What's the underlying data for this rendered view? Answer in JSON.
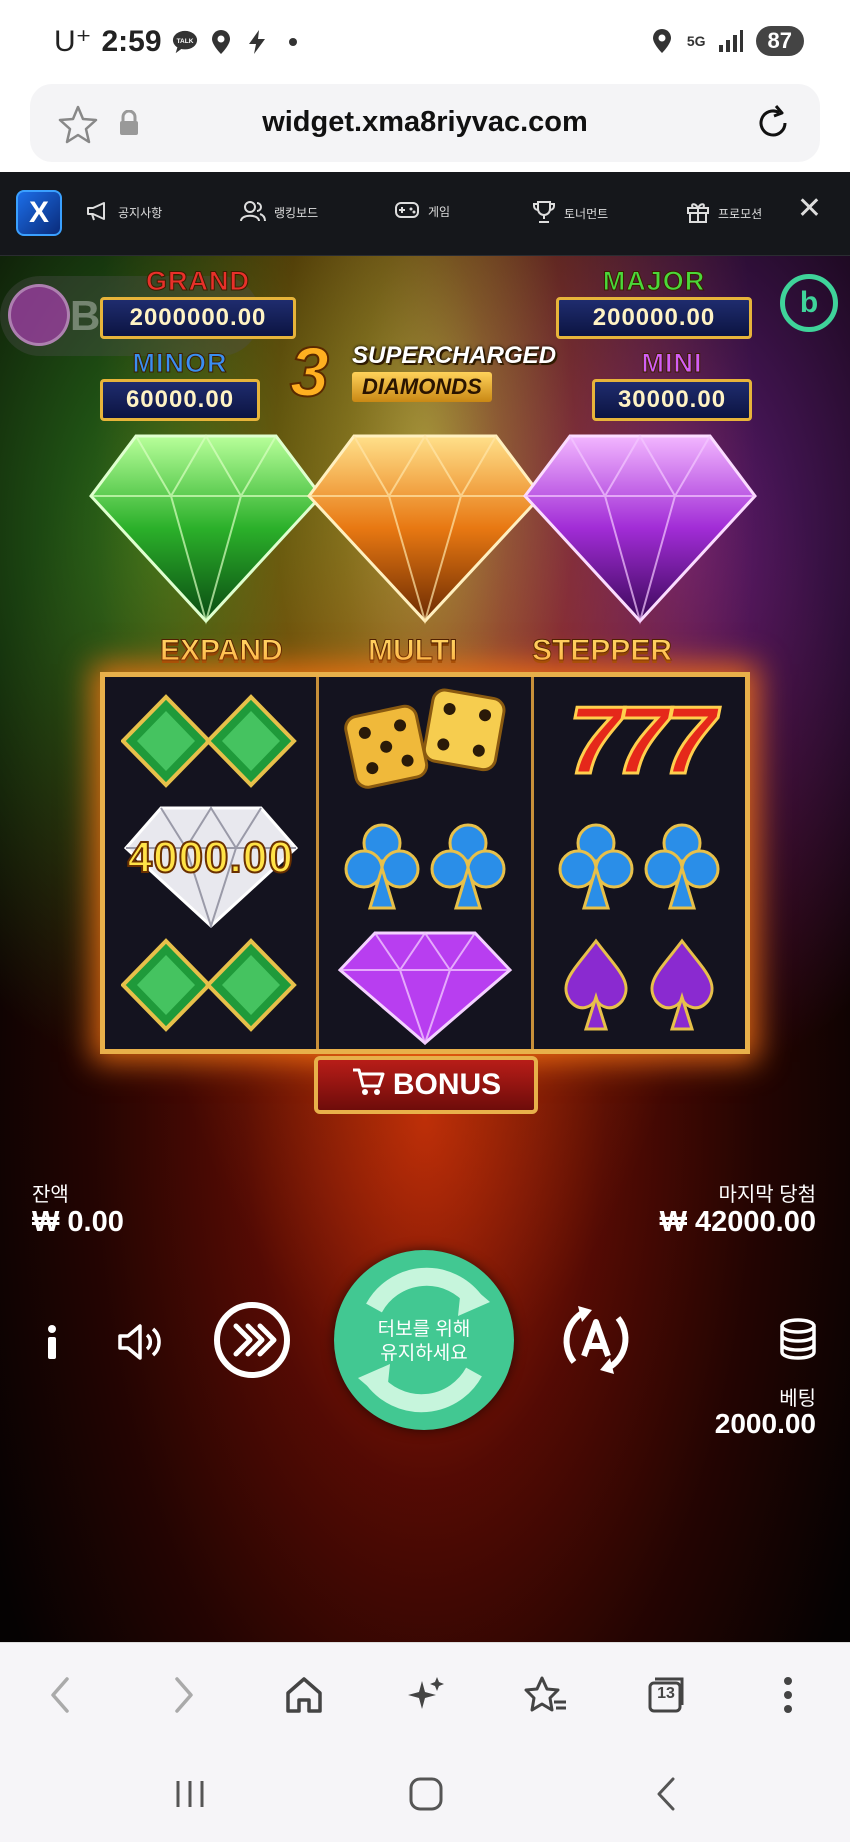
{
  "status_bar": {
    "carrier": "U⁺",
    "time": "2:59",
    "talk_badge": "TALK",
    "network": "5G",
    "battery": "87"
  },
  "url_bar": {
    "url": "widget.xma8riyvac.com"
  },
  "site_nav": {
    "logo": "X",
    "items": [
      {
        "label": "공지사항",
        "icon": "megaphone-icon"
      },
      {
        "label": "랭킹보드",
        "icon": "users-icon"
      },
      {
        "label": "게임",
        "icon": "gamepad-icon"
      },
      {
        "label": "토너먼트",
        "icon": "trophy-icon"
      },
      {
        "label": "프로모션",
        "icon": "gift-icon"
      }
    ]
  },
  "game": {
    "provider_overlay": "BNG",
    "jackpots": {
      "grand": {
        "label": "GRAND",
        "value": "2000000.00"
      },
      "major": {
        "label": "MAJOR",
        "value": "200000.00"
      },
      "minor": {
        "label": "MINOR",
        "value": "60000.00"
      },
      "mini": {
        "label": "MINI",
        "value": "30000.00"
      }
    },
    "title": {
      "number": "3",
      "line1": "SUPERCHARGED",
      "line2": "DIAMONDS"
    },
    "modes": [
      "EXPAND",
      "MULTI",
      "STEPPER"
    ],
    "reels": [
      [
        "green-diamonds",
        "white-diamond",
        "green-diamonds"
      ],
      [
        "dice",
        "blue-clubs",
        "purple-diamond"
      ],
      [
        "sevens",
        "blue-clubs",
        "purple-spades"
      ]
    ],
    "win_value": "4000.00",
    "sevens_text": "777",
    "bonus_label": "BONUS",
    "balance_label": "잔액",
    "balance_value": "₩ 0.00",
    "last_win_label": "마지막 당첨",
    "last_win_value": "₩ 42000.00",
    "spin_text_1": "터보를 위해",
    "spin_text_2": "유지하세요",
    "bet_label": "베팅",
    "bet_value": "2000.00",
    "colors": {
      "spin": "#42c892",
      "reel_border": "#e8b04a"
    }
  },
  "browser_bar": {
    "tab_count": "13"
  }
}
